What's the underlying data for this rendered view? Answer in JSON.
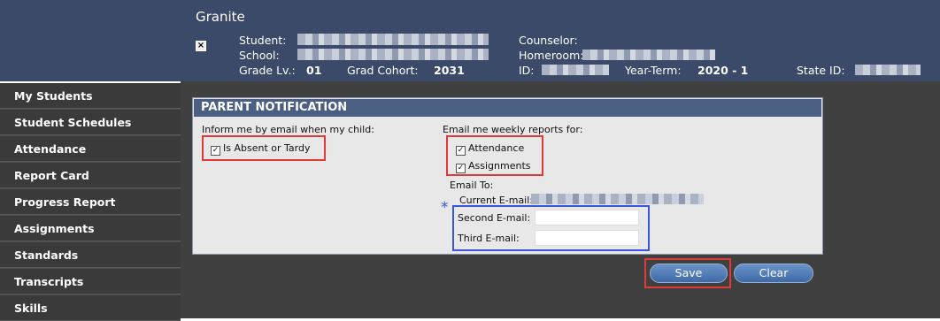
{
  "header": {
    "school_name": "Granite",
    "student_label": "Student:",
    "school_label": "School:",
    "grade_label": "Grade Lv.:",
    "grade_value": "01",
    "grad_cohort_label": "Grad Cohort:",
    "grad_cohort_value": "2031",
    "counselor_label": "Counselor:",
    "homeroom_label": "Homeroom:",
    "id_label": "ID:",
    "year_term_label": "Year-Term:",
    "year_term_value": "2020 - 1",
    "state_id_label": "State ID:",
    "close_glyph": "×"
  },
  "sidebar": {
    "items": [
      {
        "label": "My Students"
      },
      {
        "label": "Student Schedules"
      },
      {
        "label": "Attendance"
      },
      {
        "label": "Report Card"
      },
      {
        "label": "Progress Report"
      },
      {
        "label": "Assignments"
      },
      {
        "label": "Standards"
      },
      {
        "label": "Transcripts"
      },
      {
        "label": "Skills"
      }
    ]
  },
  "panel": {
    "title": "PARENT NOTIFICATION",
    "inform_label": "Inform me by email when my child:",
    "absent_label": "Is Absent or Tardy",
    "weekly_label": "Email me weekly reports for:",
    "attendance_label": "Attendance",
    "assignments_label": "Assignments",
    "email_to_label": "Email To:",
    "current_email_label": "Current E-mail:",
    "second_email_label": "Second E-mail:",
    "second_email_value": "",
    "third_email_label": "Third E-mail:",
    "third_email_value": "",
    "star": "*",
    "check_glyph": "✓"
  },
  "buttons": {
    "save": "Save",
    "clear": "Clear"
  },
  "colors": {
    "header_bg": "#3a4a68",
    "panel_title_bg": "#4a5f82",
    "highlight_red": "#e03a3a",
    "highlight_blue": "#3a55e0"
  }
}
